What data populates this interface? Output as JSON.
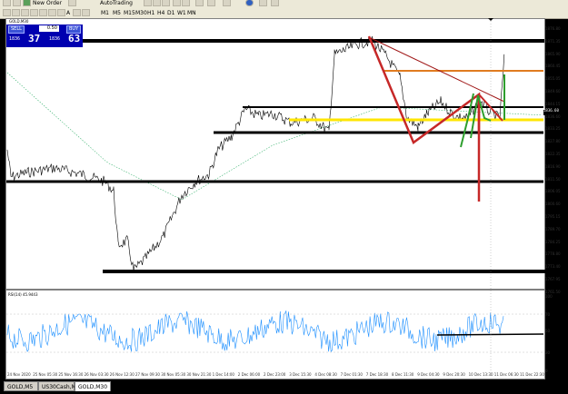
{
  "toolbar": {
    "new_order": "New Order",
    "autotrading": "AutoTrading",
    "timeframes": [
      "M1",
      "M5",
      "M15",
      "M30",
      "H1",
      "H4",
      "D1",
      "W1",
      "MN"
    ]
  },
  "chart": {
    "title": "GOLD,M30",
    "rsi_title": "RSI(14) 45.9443",
    "y_labels": [
      "1876.80",
      "1871.35",
      "1865.90",
      "1860.45",
      "1855.05",
      "1849.60",
      "1844.15",
      "1836.60",
      "1833.25",
      "1827.80",
      "1822.35",
      "1816.90",
      "1811.50",
      "1806.05",
      "1800.60",
      "1795.15",
      "1789.70",
      "1784.25",
      "1778.80",
      "1773.40",
      "1767.95",
      "1761.50"
    ],
    "rsi_labels": [
      "100",
      "70",
      "50",
      "30",
      "0"
    ],
    "x_labels": [
      "24 Nov 2020",
      "25 Nov 05:30",
      "25 Nov 16:30",
      "26 Nov 03:30",
      "26 Nov 12:30",
      "27 Nov 09:30",
      "30 Nov 05:30",
      "30 Nov 21:30",
      "1 Dec 14:00",
      "2 Dec 06:00",
      "2 Dec 23:00",
      "3 Dec 15:30",
      "4 Dec 08:30",
      "7 Dec 01:30",
      "7 Dec 18:30",
      "8 Dec 11:30",
      "9 Dec 04:30",
      "9 Dec 20:30",
      "10 Dec 13:30",
      "11 Dec 06:30",
      "11 Dec 22:30"
    ],
    "price_tag": "1836.60",
    "colors": {
      "price_line": "#000000",
      "ma_line": "#3cb371",
      "rsi_line": "#1e90ff",
      "support": "#000000",
      "yellow": "#ffe600",
      "orange": "#e07b20",
      "red_trend": "#c62828",
      "green_marks": "#2e9e2e"
    }
  },
  "trade_panel": {
    "sell_label": "SELL",
    "buy_label": "BUY",
    "lot": "0.50",
    "sell_price_small": "1836",
    "sell_price_big": "37",
    "buy_price_small": "1836",
    "buy_price_big": "63"
  },
  "tabs": [
    "GOLD,M5",
    "US30Cash,M5",
    "GOLD,M30"
  ],
  "active_tab": "GOLD,M30"
}
